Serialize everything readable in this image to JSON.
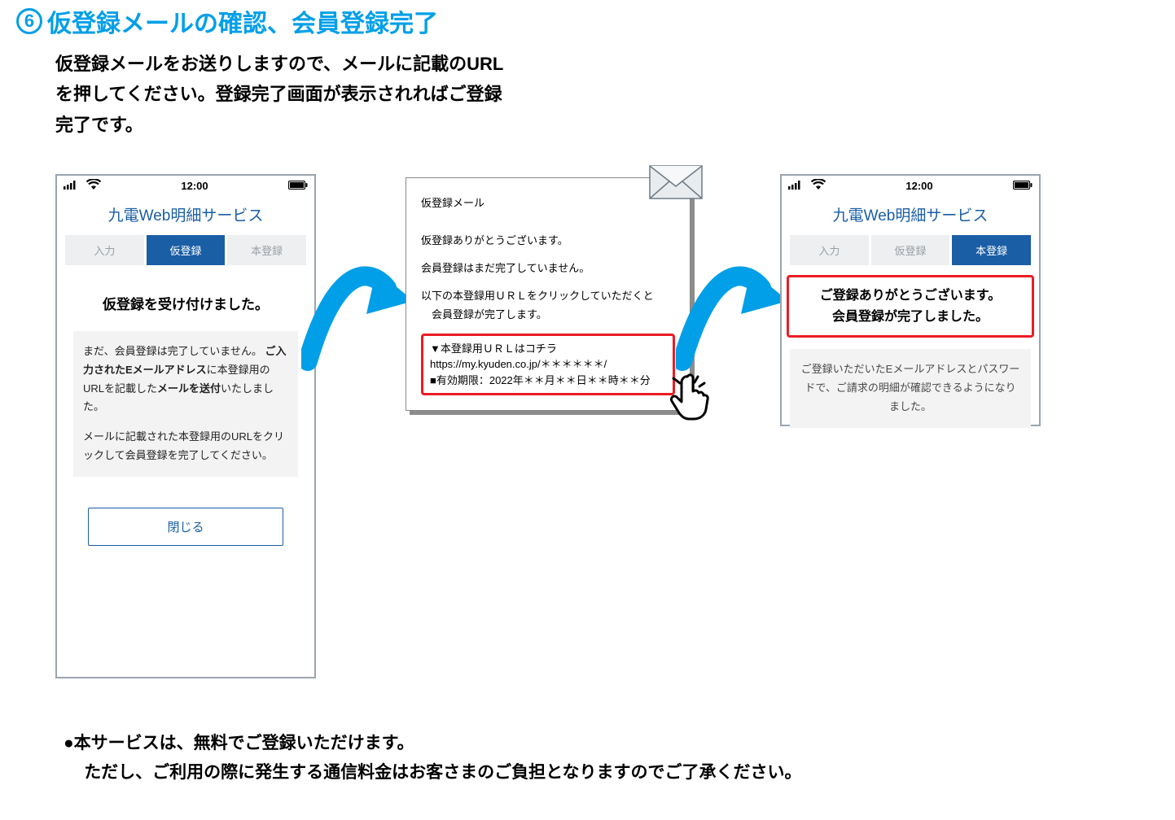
{
  "colors": {
    "accent": "#009fe8",
    "link": "#1a5ea5",
    "danger": "#eb1c24",
    "gray": "#9aa0a6",
    "grayBg": "#f3f3f3"
  },
  "title": {
    "number": "6",
    "text": "仮登録メールの確認、会員登録完了"
  },
  "lead": "仮登録メールをお送りしますので、メールに記載のURLを押してください。登録完了画面が表示されればご登録完了です。",
  "status": {
    "time": "12:00"
  },
  "svcTitle": "九電Web明細サービス",
  "steps": {
    "s1": "入力",
    "s2": "仮登録",
    "s3": "本登録"
  },
  "screenA": {
    "heading": "仮登録を受け付けました。",
    "para1a": "まだ、会員登録は完了していません。",
    "para1b": "ご入力されたEメールアドレス",
    "para1c": "に本登録用のURLを記載した",
    "para1d": "メールを送付",
    "para1e": "いたしました。",
    "para2": "メールに記載された本登録用のURLをクリックして会員登録を完了してください。",
    "closeBtn": "閉じる"
  },
  "email": {
    "subject": "仮登録メール",
    "line1": "仮登録ありがとうございます。",
    "line2": "会員登録はまだ完了していません。",
    "line3a": "以下の本登録用ＵＲＬをクリックしていただくと",
    "line3b": "会員登録が完了します。",
    "hi1": "▼本登録用ＵＲＬはコチラ",
    "hi2": "https://my.kyuden.co.jp/＊＊＊＊＊＊/",
    "hi3": "■有効期限：2022年＊＊月＊＊日＊＊時＊＊分"
  },
  "screenB": {
    "heading1": "ご登録ありがとうございます。",
    "heading2": "会員登録が完了しました。",
    "note": "ご登録いただいたEメールアドレスとパスワードで、ご請求の明細が確認できるようになりました。"
  },
  "footnote": {
    "l1": "●本サービスは、無料でご登録いただけます。",
    "l2": "ただし、ご利用の際に発生する通信料金はお客さまのご負担となりますのでご了承ください。"
  }
}
